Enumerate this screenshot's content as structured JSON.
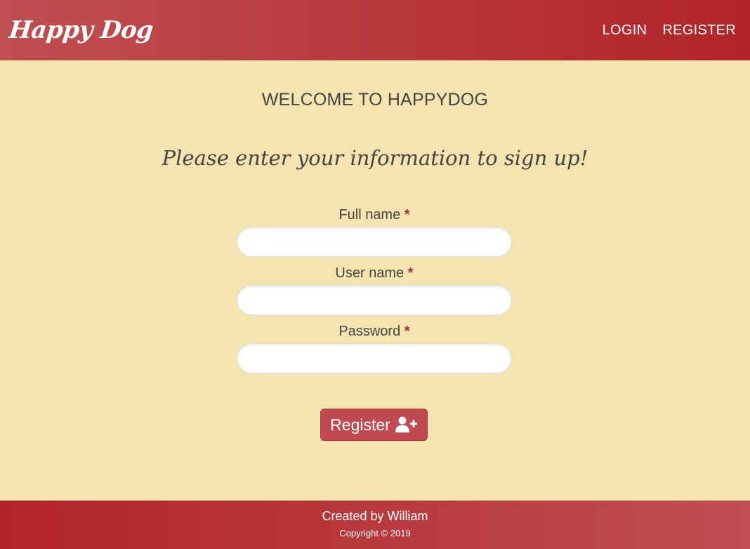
{
  "nav": {
    "brand": "Happy Dog",
    "links": [
      {
        "label": "LOGIN"
      },
      {
        "label": "REGISTER"
      }
    ]
  },
  "main": {
    "welcome": "WELCOME TO HAPPYDOG",
    "prompt": "Please enter your information to sign up!",
    "fields": [
      {
        "label": "Full name",
        "required": "*",
        "value": ""
      },
      {
        "label": "User name",
        "required": "*",
        "value": ""
      },
      {
        "label": "Password",
        "required": "*",
        "value": ""
      }
    ],
    "submit": {
      "label": "Register",
      "icon": "user-plus-icon"
    }
  },
  "footer": {
    "credit": "Created by William",
    "copyright": "Copyright © 2019"
  },
  "colors": {
    "background": "#f4e4b0",
    "navbar_left": "#c04e52",
    "navbar_right": "#b22428",
    "button": "#c14a52",
    "required": "#b22438"
  }
}
